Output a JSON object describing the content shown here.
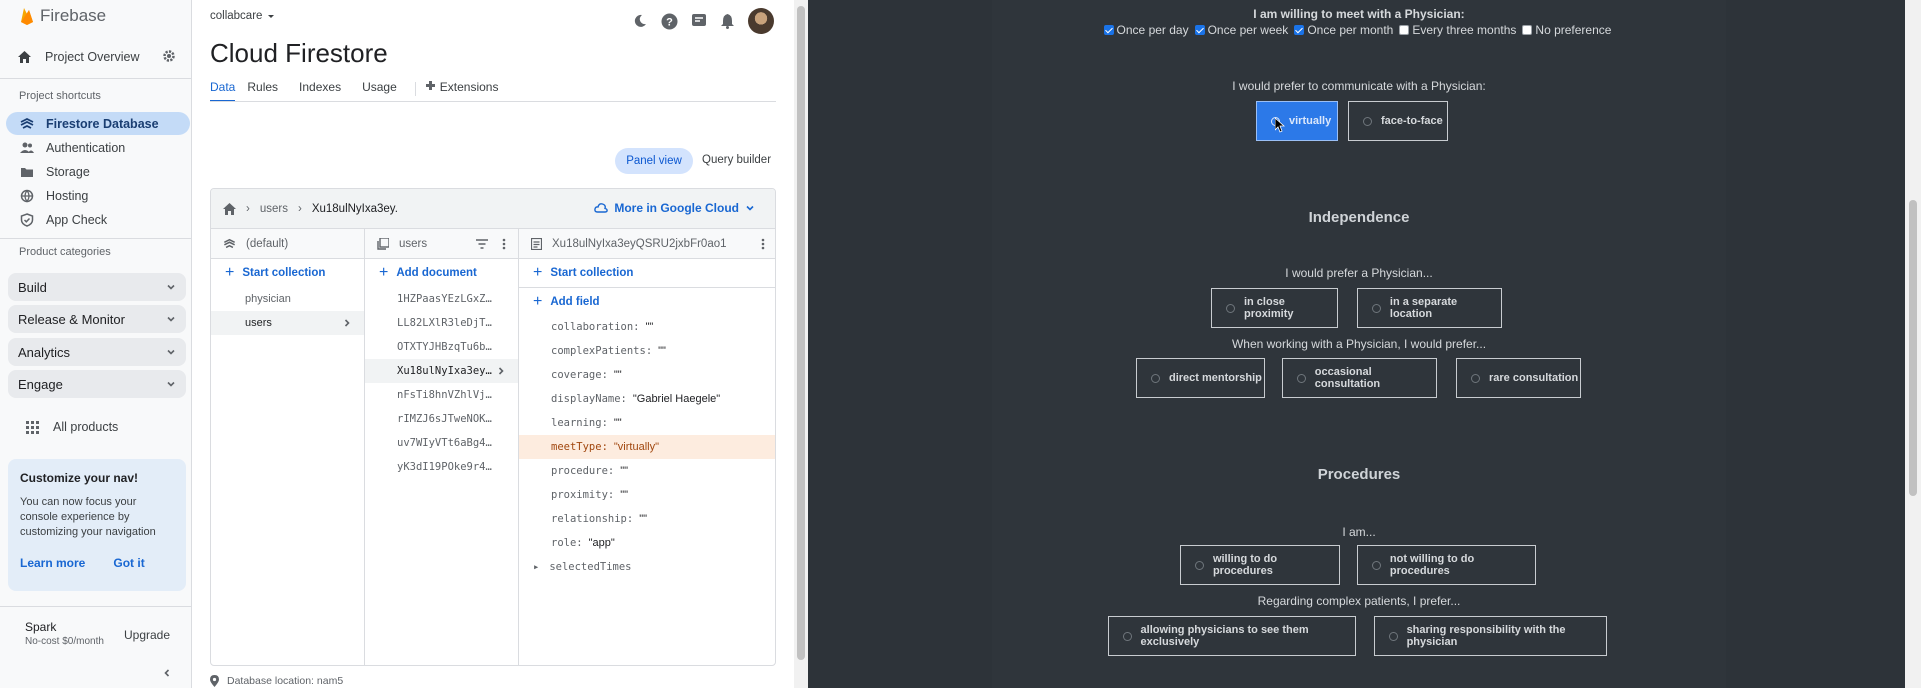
{
  "nav": {
    "brand": "Firebase",
    "project_overview": "Project Overview",
    "shortcuts_title": "Project shortcuts",
    "shortcuts": [
      {
        "label": "Firestore Database",
        "icon": "firestore-icon"
      },
      {
        "label": "Authentication",
        "icon": "people-icon"
      },
      {
        "label": "Storage",
        "icon": "folder-icon"
      },
      {
        "label": "Hosting",
        "icon": "globe-icon"
      },
      {
        "label": "App Check",
        "icon": "shield-icon"
      }
    ],
    "categories_title": "Product categories",
    "categories": [
      "Build",
      "Release & Monitor",
      "Analytics",
      "Engage"
    ],
    "all_products": "All products",
    "customize": {
      "title": "Customize your nav!",
      "body": "You can now focus your console experience by customizing your navigation",
      "learn_more": "Learn more",
      "got_it": "Got it"
    },
    "plan": {
      "name": "Spark",
      "sub": "No-cost $0/month",
      "upgrade": "Upgrade"
    }
  },
  "header": {
    "project": "collabcare",
    "title": "Cloud Firestore",
    "tabs": [
      "Data",
      "Rules",
      "Indexes",
      "Usage",
      "Extensions"
    ]
  },
  "view": {
    "panel_view": "Panel view",
    "query_builder": "Query builder"
  },
  "breadcrumb": {
    "path1": "users",
    "path2": "Xu18ulNyIxa3ey.",
    "more": "More in Google Cloud"
  },
  "columns": {
    "root": {
      "title": "(default)",
      "add": "Start collection",
      "items": [
        "physician",
        "users"
      ]
    },
    "collection": {
      "title": "users",
      "add": "Add document",
      "items": [
        "1HZPaasYEzLGxZ…",
        "LL82LXlR3leDjT…",
        "OTXTYJHBzqTu6b…",
        "Xu18ulNyIxa3ey…",
        "nFsTi8hnVZhlVj…",
        "rIMZJ6sJTweNOK…",
        "uv7WIyVTt6aBg4…",
        "yK3dI19POke9r4…"
      ]
    },
    "document": {
      "title": "Xu18ulNyIxa3eyQSRU2jxbFr0ao1",
      "start_collection": "Start collection",
      "add_field": "Add field",
      "fields": [
        {
          "key": "collaboration:",
          "value": "\"\""
        },
        {
          "key": "complexPatients:",
          "value": "\"\""
        },
        {
          "key": "coverage:",
          "value": "\"\""
        },
        {
          "key": "displayName:",
          "value": "\"Gabriel Haegele\""
        },
        {
          "key": "learning:",
          "value": "\"\""
        },
        {
          "key": "meetType:",
          "value": "\"virtually\""
        },
        {
          "key": "procedure:",
          "value": "\"\""
        },
        {
          "key": "proximity:",
          "value": "\"\""
        },
        {
          "key": "relationship:",
          "value": "\"\""
        },
        {
          "key": "role:",
          "value": "\"app\""
        },
        {
          "key": "selectedTimes",
          "value": ""
        }
      ]
    }
  },
  "footer": {
    "db_location": "Database location: nam5"
  },
  "app": {
    "q_meet": "I am willing to meet with a Physician:",
    "frequency": [
      {
        "label": "Once per day",
        "checked": true
      },
      {
        "label": "Once per week",
        "checked": true
      },
      {
        "label": "Once per month",
        "checked": true
      },
      {
        "label": "Every three months",
        "checked": false
      },
      {
        "label": "No preference",
        "checked": false
      }
    ],
    "q_communicate": "I would prefer to communicate with a Physician:",
    "communicate": [
      "virtually",
      "face-to-face"
    ],
    "independence_title": "Independence",
    "q_prefer": "I would prefer a Physician...",
    "proximity": [
      "in close proximity",
      "in a separate location"
    ],
    "q_working": "When working with a Physician, I would prefer...",
    "working": [
      "direct mentorship",
      "occasional consultation",
      "rare consultation"
    ],
    "procedures_title": "Procedures",
    "q_iam": "I am...",
    "procedures": [
      "willing to do procedures",
      "not willing to do procedures"
    ],
    "q_complex": "Regarding complex patients, I prefer...",
    "complex": [
      "allowing physicians to see them exclusively",
      "sharing responsibility with the physician"
    ]
  },
  "colors": {
    "accent": "#1967d2",
    "selected_option": "#2c79e8",
    "dark_bg": "#2d3339",
    "highlight": "#fdecdf"
  }
}
